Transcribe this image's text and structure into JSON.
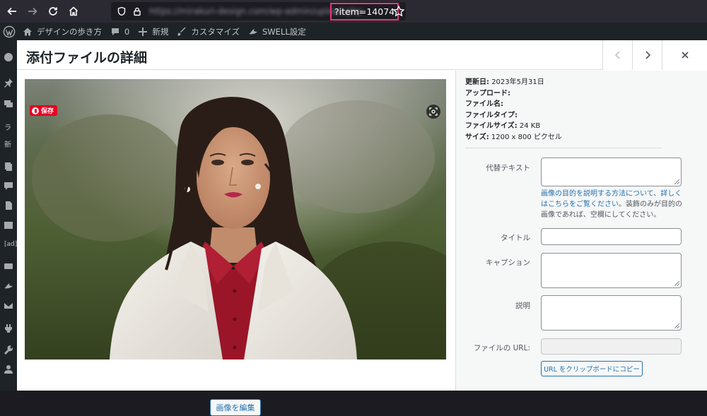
{
  "browser": {
    "url_host_blurred": "https://mirakuri-design.com/wp-admin/upload.php",
    "url_query": "?item=14074"
  },
  "adminbar": {
    "site_name": "デザインの歩き方",
    "comments_count": "0",
    "new_label": "新規",
    "customize_label": "カスタマイズ",
    "swell_label": "SWELL設定"
  },
  "sidebar": {
    "text1": "ラ",
    "text2": "新"
  },
  "modal": {
    "title": "添付ファイルの詳細",
    "pin_label": "保存",
    "edit_image_label": "画像を編集"
  },
  "details": {
    "updated_label": "更新日:",
    "updated_value": "2023年5月31日",
    "uploaded_label": "アップロード:",
    "filename_label": "ファイル名:",
    "filetype_label": "ファイルタイプ:",
    "filesize_label": "ファイルサイズ:",
    "filesize_value": "24 KB",
    "size_label": "サイズ:",
    "size_value": "1200 x 800 ピクセル"
  },
  "fields": {
    "alt_label": "代替テキスト",
    "alt_help_link": "画像の目的を説明する方法について、詳しくはこちらをご覧ください",
    "alt_help_text": "。装飾のみが目的の画像であれば、空欄にしてください。",
    "title_label": "タイトル",
    "caption_label": "キャプション",
    "description_label": "説明",
    "url_label": "ファイルの URL:",
    "copy_label": "URL をクリップボードにコピー"
  }
}
